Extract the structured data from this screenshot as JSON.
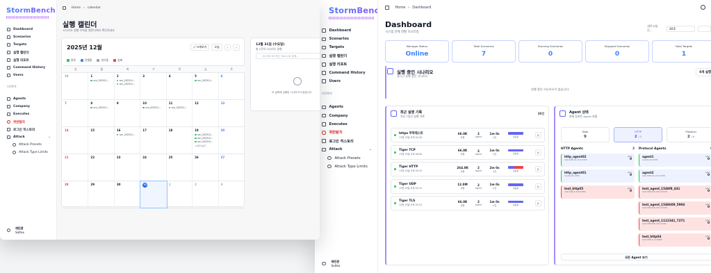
{
  "brand": "StormBench",
  "nav": {
    "dashboard": "Dashboard",
    "scenarios": "Scenarios",
    "targets": "Targets",
    "calendar": "실행 캘린더",
    "reports": "실행 리포트",
    "command_history": "Command History",
    "users": "Users",
    "admin": "ADMIN",
    "agents": "Agents",
    "company": "Company",
    "executes": "Executes",
    "violations": "위반탐지",
    "login_history": "로그인 히스토리",
    "attack": "Attack",
    "attack_presets": "Attack Presets",
    "attack_type_limits": "Attack Type Limits"
  },
  "user": {
    "name": "재민관",
    "org": "Soltex"
  },
  "calendar_page": {
    "breadcrumb_home": "Home",
    "breadcrumb_current": "calendar",
    "title": "실행 캘린더",
    "subtitle": "시나리오 실행 이력을 캘린더에서 확인하세요",
    "month_title": "2025년 12월",
    "fullscreen": "크게보기",
    "today": "오늘",
    "prev": "‹",
    "next": "›",
    "legend": [
      {
        "label": "완료",
        "color": "#22c55e"
      },
      {
        "label": "진행중",
        "color": "#3b82f6"
      },
      {
        "label": "대기중",
        "color": "#9ca3af"
      },
      {
        "label": "실패",
        "color": "#ef4444"
      }
    ],
    "weekdays": [
      "일",
      "월",
      "화",
      "수",
      "목",
      "금",
      "토"
    ],
    "weeks": [
      [
        {
          "d": "30",
          "m": true
        },
        {
          "d": "1",
          "ev": [
            "scn_202511..."
          ]
        },
        {
          "d": "2",
          "ev": [
            "scn_202511...",
            "scn_202511..."
          ]
        },
        {
          "d": "3"
        },
        {
          "d": "4"
        },
        {
          "d": "5",
          "ev": [
            "scn_202511..."
          ]
        },
        {
          "d": "6"
        }
      ],
      [
        {
          "d": "7"
        },
        {
          "d": "8",
          "ev": [
            "scn_202511..."
          ]
        },
        {
          "d": "9"
        },
        {
          "d": "10",
          "ev": [
            "scn_202511..."
          ]
        },
        {
          "d": "11",
          "ev": [
            "scn_202511..."
          ]
        },
        {
          "d": "12"
        },
        {
          "d": "13"
        }
      ],
      [
        {
          "d": "14"
        },
        {
          "d": "15"
        },
        {
          "d": "16",
          "ev": [
            "scn_202511..."
          ]
        },
        {
          "d": "17"
        },
        {
          "d": "18"
        },
        {
          "d": "19",
          "ev": [
            "scn_202512...",
            "scn_202512...",
            "scn_202512..."
          ],
          "more": "+8개 더보기"
        },
        {
          "d": "20"
        }
      ],
      [
        {
          "d": "21"
        },
        {
          "d": "22"
        },
        {
          "d": "23"
        },
        {
          "d": "24"
        },
        {
          "d": "25"
        },
        {
          "d": "26"
        },
        {
          "d": "27"
        }
      ],
      [
        {
          "d": "28"
        },
        {
          "d": "29"
        },
        {
          "d": "30"
        },
        {
          "d": "31",
          "today": true
        },
        {
          "d": "1",
          "m": true
        },
        {
          "d": "2",
          "m": true
        },
        {
          "d": "3",
          "m": true
        }
      ]
    ],
    "day_panel": {
      "title": "12월 31일 (수요일)",
      "subtitle": "총 0건의 시나리오 실행",
      "search_placeholder": "시나리오 ID 또는 Trans ID 검색...",
      "empty": "이 날짜에 실행된 시나리오가 없습니다"
    }
  },
  "dashboard": {
    "breadcrumb_home": "Home",
    "breadcrumb_current": "Dashboard",
    "title": "Dashboard",
    "subtitle": "시스템 전체 현황 모니터링",
    "refresh_label": "새로고침 간...",
    "refresh_value": "30초",
    "stats": [
      {
        "label": "Manager Status",
        "value": "Online"
      },
      {
        "label": "Total Scenarios",
        "value": "7"
      },
      {
        "label": "Running Scenarios",
        "value": "0"
      },
      {
        "label": "Stopped Scenarios",
        "value": "0"
      },
      {
        "label": "Total Targets",
        "value": "1"
      }
    ],
    "running": {
      "title": "실행 중인 시나리오",
      "subtitle": "실시간 실행 중인 시나리오",
      "button": "0개 실행",
      "empty": "실행 중인 시나리오가 없습니다."
    },
    "recent": {
      "title": "최근 실행 기록",
      "subtitle": "지난 7일간 실행 기록",
      "count": "30건",
      "items": [
        {
          "name": "https 부하테스트",
          "time": "12월 19일 오후 02:50",
          "req": "66.0K",
          "req_l": "요청",
          "agents": "2",
          "agents_l": "Agent",
          "dur": "1m 0s",
          "dur_l": "시간",
          "status": "성공률",
          "mix": false
        },
        {
          "name": "Tiger TCP",
          "time": "12월 19일 오후 06:00",
          "req": "66.0K",
          "req_l": "요청",
          "agents": "2",
          "agents_l": "Agent",
          "dur": "1m 0s",
          "dur_l": "시간",
          "status": "성공률",
          "mix": false
        },
        {
          "name": "Tiger HTTP",
          "time": "12월 19일 오후 05:33",
          "req": "264.0K",
          "req_l": "요청",
          "agents": "2",
          "agents_l": "Agent",
          "dur": "2m 0s",
          "dur_l": "시간",
          "status": "성공률",
          "mix": true
        },
        {
          "name": "Tiger UDP",
          "time": "12월 19일 오후 05:14",
          "req": "12.0M",
          "req_l": "요청",
          "agents": "2",
          "agents_l": "Agent",
          "dur": "1m 0s",
          "dur_l": "시간",
          "status": "성공률",
          "mix": false
        },
        {
          "name": "Tiger TLS",
          "time": "12월 19일 오후 05:23",
          "req": "66.0K",
          "req_l": "요청",
          "agents": "2",
          "agents_l": "Agent",
          "dur": "1m 0s",
          "dur_l": "시간",
          "status": "성공률",
          "mix": false
        }
      ]
    },
    "agents": {
      "title": "Agent 상태",
      "subtitle": "현재 등록된 Agent 현황",
      "tabs": [
        {
          "label": "Total",
          "value": "9",
          "sub": ""
        },
        {
          "label": "HTTP",
          "value": "2",
          "sub": "/ 3"
        },
        {
          "label": "Protocol",
          "value": "2",
          "sub": "/ 6"
        }
      ],
      "http_title": "HTTP Agents",
      "http_count": "3",
      "protocol_title": "Protocol Agents",
      "protocol_count": "6",
      "jobs_label": "Jobs",
      "http_list": [
        {
          "name": "http_agent02",
          "ip": "192.168.10.112:1330",
          "jobs": "0",
          "ok": true
        },
        {
          "name": "http_agent01",
          "ip": "localhost:1330",
          "jobs": "0",
          "ok": true
        },
        {
          "name": "test_http05",
          "ip": "192.168.3.233:8080",
          "jobs": "0",
          "ok": false
        }
      ],
      "protocol_list": [
        {
          "name": "agent1",
          "ip": "localhost:1338",
          "jobs": "0",
          "ok": true
        },
        {
          "name": "agent2",
          "ip": "192.168.10.112:1338",
          "jobs": "0",
          "ok": true
        },
        {
          "name": "test_agent_1548f8_441",
          "ip": "192.168.255.251:20479",
          "jobs": "0",
          "ok": false
        },
        {
          "name": "test_agent_1548609_5904",
          "ip": "192.168.255.251:33330",
          "jobs": "0",
          "ok": false
        },
        {
          "name": "test_agent_1112341_7271",
          "ip": "192.168.255.251:1330",
          "jobs": "0",
          "ok": false
        },
        {
          "name": "test_http04",
          "ip": "192.168.3.11:8080",
          "jobs": "0",
          "ok": false
        }
      ],
      "all_button": "모든 Agent 보기"
    }
  }
}
